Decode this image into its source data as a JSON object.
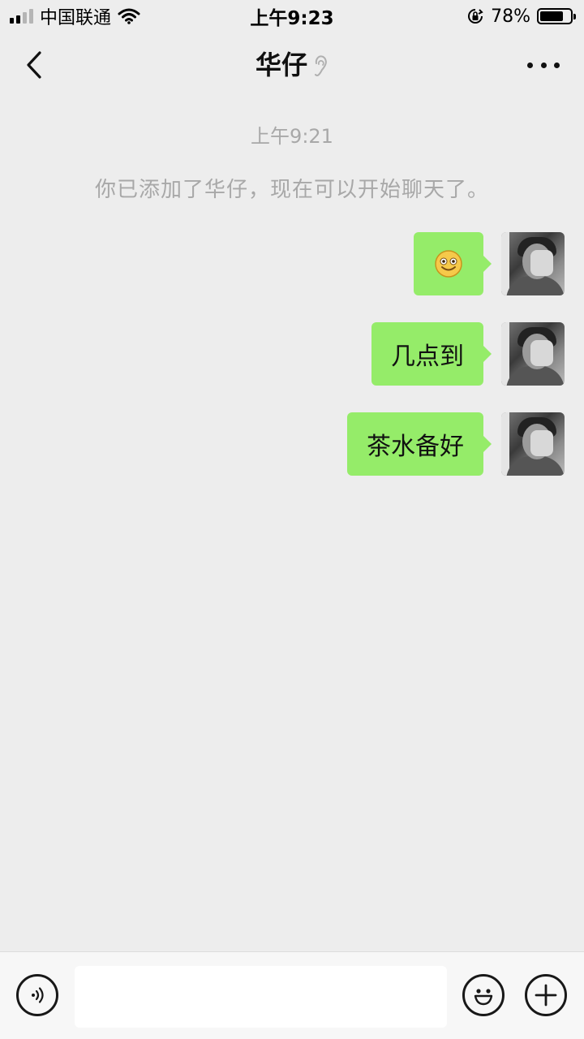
{
  "status_bar": {
    "carrier": "中国联通",
    "time": "上午9:23",
    "battery_percent": "78%",
    "battery_level": 0.78,
    "icons": [
      "signal-icon",
      "wifi-icon",
      "rotation-lock-icon",
      "battery-icon"
    ]
  },
  "nav": {
    "title": "华仔",
    "back_icon": "chevron-left-icon",
    "mute_icon": "ear-icon",
    "more_icon": "more-dots-icon"
  },
  "chat": {
    "timestamp": "上午9:21",
    "system_message": "你已添加了华仔，现在可以开始聊天了。",
    "messages": [
      {
        "sender": "self",
        "type": "emoji",
        "emoji": "🙂",
        "icon": "smiley-emoji-icon"
      },
      {
        "sender": "self",
        "type": "text",
        "text": "几点到"
      },
      {
        "sender": "self",
        "type": "text",
        "text": "茶水备好"
      }
    ]
  },
  "input_bar": {
    "voice_icon": "voice-icon",
    "input_value": "",
    "emoji_icon": "emoji-icon",
    "plus_icon": "plus-icon"
  },
  "colors": {
    "background": "#ededed",
    "bubble_self": "#95ec69",
    "system_text": "#a8a8a8",
    "input_bar": "#f7f7f7"
  }
}
